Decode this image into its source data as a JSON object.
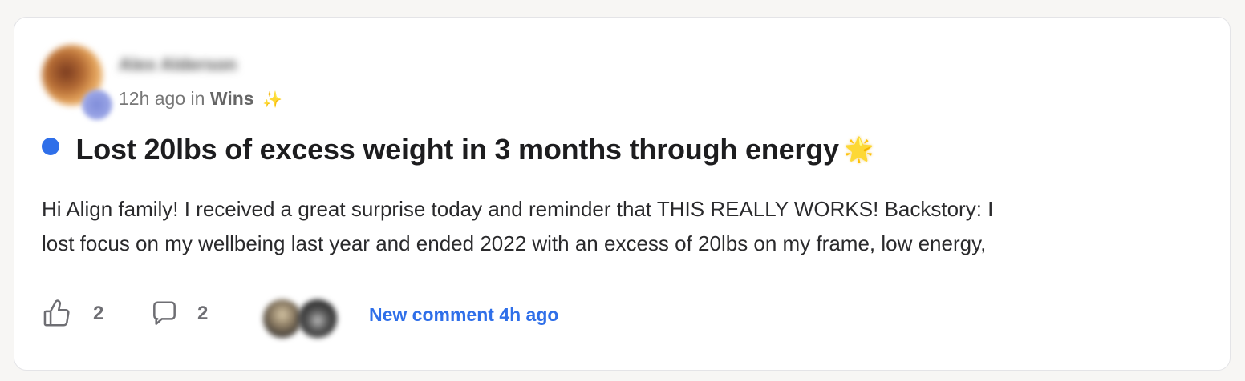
{
  "post": {
    "author_name": "Alex Alderson",
    "time_ago": "12h ago",
    "in_label": "in",
    "space_name": "Wins",
    "space_emoji": "✨",
    "title": "Lost 20lbs of excess weight in 3 months through energy",
    "title_emoji": "🌟",
    "body_line1": "Hi Align family! I received a great surprise today and reminder that THIS REALLY WORKS! Backstory: I",
    "body_line2": "lost focus on my wellbeing last year and ended 2022 with an excess of 20lbs on my frame, low energy,",
    "unread": true
  },
  "footer": {
    "like_count": "2",
    "comment_count": "2",
    "new_comment_text": "New comment 4h ago"
  },
  "colors": {
    "accent": "#2f6fe9",
    "title": "#1d1d1f",
    "muted": "#777777",
    "card_border": "#e4e4e7"
  },
  "icons": {
    "like": "thumbs-up-icon",
    "comment": "comment-bubble-icon"
  }
}
